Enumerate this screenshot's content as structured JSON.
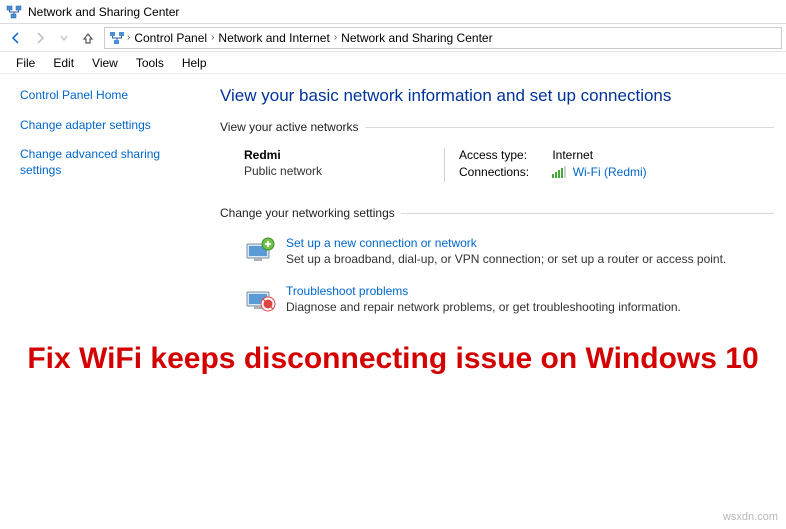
{
  "window": {
    "title": "Network and Sharing Center"
  },
  "breadcrumb": {
    "root": "Control Panel",
    "mid": "Network and Internet",
    "leaf": "Network and Sharing Center"
  },
  "menu": {
    "file": "File",
    "edit": "Edit",
    "view": "View",
    "tools": "Tools",
    "help": "Help"
  },
  "sidebar": {
    "home": "Control Panel Home",
    "adapter": "Change adapter settings",
    "advanced": "Change advanced sharing settings"
  },
  "main": {
    "heading": "View your basic network information and set up connections",
    "active_networks_label": "View your active networks",
    "network": {
      "name": "Redmi",
      "type": "Public network",
      "access_label": "Access type:",
      "access_value": "Internet",
      "conn_label": "Connections:",
      "conn_value": "Wi-Fi (Redmi)"
    },
    "change_label": "Change your networking settings",
    "opt1": {
      "title": "Set up a new connection or network",
      "desc": "Set up a broadband, dial-up, or VPN connection; or set up a router or access point."
    },
    "opt2": {
      "title": "Troubleshoot problems",
      "desc": "Diagnose and repair network problems, or get troubleshooting information."
    }
  },
  "overlay": "Fix WiFi keeps disconnecting issue on Windows 10",
  "watermark": "wsxdn.com"
}
